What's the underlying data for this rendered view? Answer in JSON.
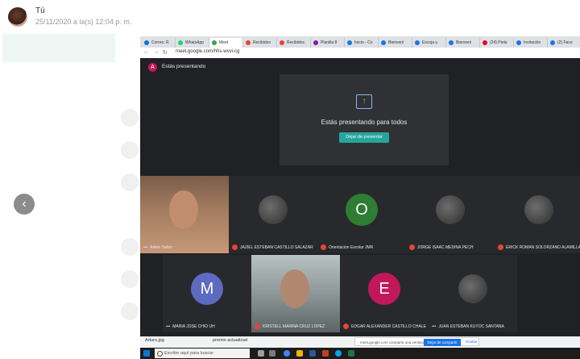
{
  "chat": {
    "sender": "Tú",
    "timestamp": "25/11/2020 a la(s) 12:04 p. m."
  },
  "browser": {
    "tabs": [
      {
        "label": "Correo: R",
        "color": "#0078d4"
      },
      {
        "label": "WhatsApp",
        "color": "#25d366"
      },
      {
        "label": "Meet",
        "color": "#34a853",
        "active": true
      },
      {
        "label": "Recibidos",
        "color": "#ea4335"
      },
      {
        "label": "Recibidos",
        "color": "#ea4335"
      },
      {
        "label": "Planilla 8",
        "color": "#7b1fa2"
      },
      {
        "label": "Inicio - Co",
        "color": "#1a73e8"
      },
      {
        "label": "Bienveni",
        "color": "#1a73e8"
      },
      {
        "label": "Escoja u",
        "color": "#1a73e8"
      },
      {
        "label": "Bienveni",
        "color": "#1a73e8"
      },
      {
        "label": "(24) Pinte",
        "color": "#e60023"
      },
      {
        "label": "Invitación",
        "color": "#1a73e8"
      },
      {
        "label": "(2) Face",
        "color": "#1877f2"
      }
    ],
    "url": "meet.google.com/hhs-wvvi-cg"
  },
  "meet": {
    "presenter_initial": "A",
    "presenting_label": "Estás presentando",
    "card_text": "Estás presentando para todos",
    "stop_button": "Dejar de presentar",
    "participants_row1": [
      {
        "name": "Adela Tadeo",
        "type": "video"
      },
      {
        "name": "JAZIEL ESTEBAN CASTILLO SALAZAR",
        "type": "photo"
      },
      {
        "name": "Orientación Escolar JMR",
        "type": "letter",
        "letter": "O",
        "color": "#2e7d32"
      },
      {
        "name": "JORGE ISAAC MEDINA PECH",
        "type": "photo"
      },
      {
        "name": "ERICK ROMAN SOLORZANO ALAMILLA",
        "type": "photo"
      }
    ],
    "participants_row2": [
      {
        "name": "MARIA JOSE CHIO UH",
        "type": "letter",
        "letter": "M",
        "color": "#5c6bc0"
      },
      {
        "name": "KRISTELL MARINA CRUZ LOPEZ",
        "type": "video"
      },
      {
        "name": "EDGAR ALEXANDER CASTILLO CHALE",
        "type": "letter",
        "letter": "E",
        "color": "#c2185b"
      },
      {
        "name": "JUAN ESTEBAN KUYOC SANTANA",
        "type": "photo"
      }
    ]
  },
  "downloads": {
    "file1": "Arturo.jpg",
    "file2": "premio actualizad",
    "notice_text": "meet.google.com comparte una ventana.",
    "share_button": "Dejar de compartir",
    "hide_button": "Ocultar"
  },
  "taskbar": {
    "search_placeholder": "Escribe aquí para buscar"
  }
}
